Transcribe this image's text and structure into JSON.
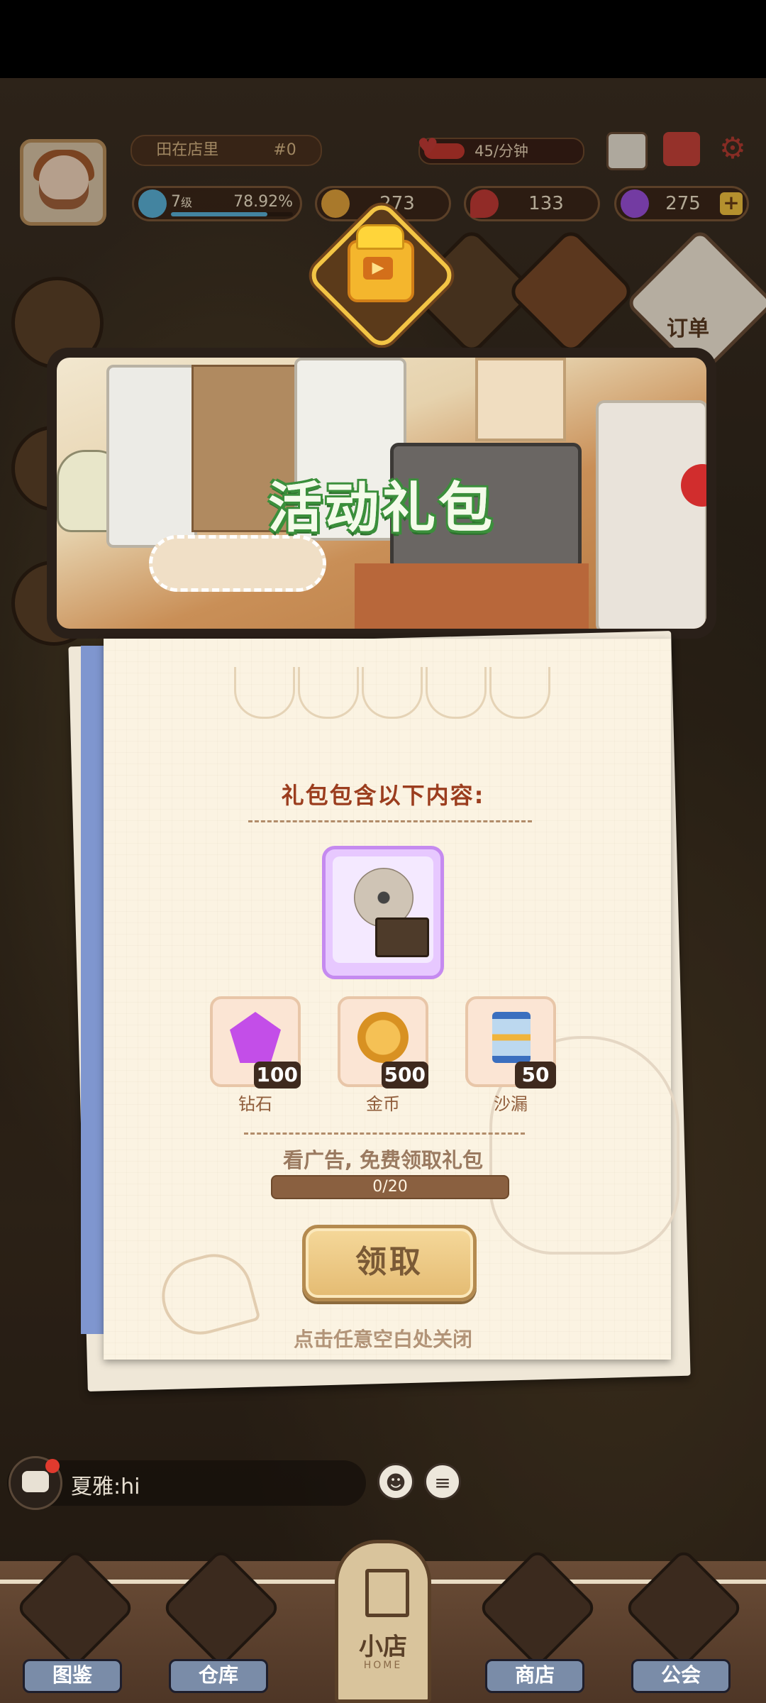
{
  "hud": {
    "shop_name": "田在店里",
    "shop_id": "#0",
    "rate_text": "45/分钟",
    "rate_fill": 0.3,
    "level_num": "7",
    "level_unit": "级",
    "level_pct": "78.92%",
    "level_progress": 0.7892,
    "coins": "273",
    "hearts": "133",
    "gems": "275",
    "plus_label": "+",
    "gear_glyph": "⚙"
  },
  "side": {
    "order_label": "订单",
    "video_play_glyph": "▶"
  },
  "banner": {
    "title": "活动礼包"
  },
  "panel": {
    "title": "礼包包含以下内容:",
    "main_item_icon": "phonograph-icon",
    "items": [
      {
        "label": "钻石",
        "qty": "100",
        "icon": "gem-icon"
      },
      {
        "label": "金币",
        "qty": "500",
        "icon": "coin-icon"
      },
      {
        "label": "沙漏",
        "qty": "50",
        "icon": "hourglass-icon"
      }
    ],
    "ad_text": "看广告, 免费领取礼包",
    "progress_text": "0/20",
    "progress_value": 0,
    "claim_label": "领取",
    "close_hint": "点击任意空白处关闭"
  },
  "chat": {
    "message": "夏雅:hi",
    "emoji_glyph": "☻",
    "menu_glyph": "≡"
  },
  "nav": {
    "items": [
      {
        "label": "图鉴"
      },
      {
        "label": "仓库"
      },
      {
        "label": "商店"
      },
      {
        "label": "公会"
      }
    ],
    "home_label": "小店",
    "home_sub": "HOME"
  },
  "colors": {
    "accent_title": "#9b3d1e",
    "claim_button": "#e4bb72",
    "banner_title_stroke": "#3b8f3b",
    "gem": "#c34ee8",
    "heart": "#c23a35"
  }
}
